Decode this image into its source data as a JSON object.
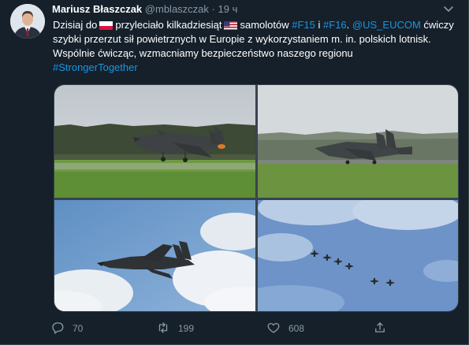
{
  "tweet": {
    "author_name": "Mariusz Błaszczak",
    "author_handle": "@mblaszczak",
    "separator": "·",
    "time": "19 ч",
    "text": {
      "t1": "Dzisiaj do",
      "t2": "przyleciało kilkadziesiąt",
      "t3": "samolotów",
      "hashtag_f15": "#F15",
      "t4": "i",
      "hashtag_f16": "#F16",
      "t5": ".",
      "mention": "@US_EUCOM",
      "t6": "ćwiczy szybki przerzut sił powietrznych w Europie z wykorzystaniem m. in. polskich lotnisk. Wspólnie ćwicząc, wzmacniamy bezpieczeństwo naszego regionu",
      "hashtag_stronger": "#StrongerTogether"
    },
    "flags": [
      "poland-flag",
      "usa-flag"
    ]
  },
  "actions": {
    "reply_count": "70",
    "retweet_count": "199",
    "like_count": "608"
  },
  "icons": [
    "chevron-down-icon",
    "reply-icon",
    "retweet-icon",
    "like-icon",
    "share-icon"
  ],
  "colors": {
    "background": "#15202b",
    "link": "#1b95e0",
    "secondary_text": "#8899a6",
    "border": "#38444d"
  }
}
